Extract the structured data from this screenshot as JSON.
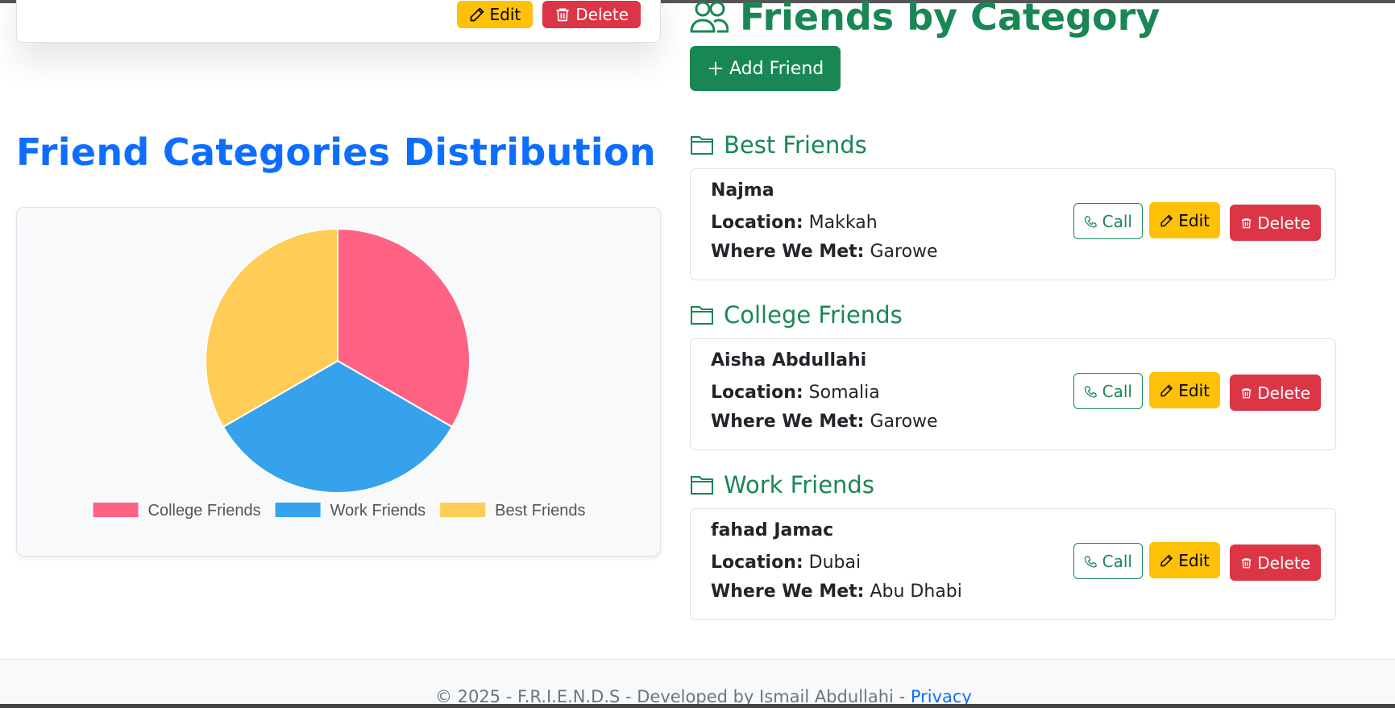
{
  "previous_card": {
    "edit_label": "Edit",
    "delete_label": "Delete"
  },
  "distribution": {
    "title": "Friend Categories Distribution"
  },
  "chart_data": {
    "type": "pie",
    "categories": [
      "College Friends",
      "Work Friends",
      "Best Friends"
    ],
    "values": [
      1,
      1,
      1
    ],
    "colors": [
      "#ff6384",
      "#36a2eb",
      "#ffcd56"
    ],
    "legend_position": "bottom"
  },
  "categories_panel": {
    "title": "Friends by Category",
    "add_button_label": "Add Friend"
  },
  "labels": {
    "location": "Location:",
    "where_met": "Where We Met:",
    "call": "Call",
    "edit": "Edit",
    "delete": "Delete"
  },
  "groups": [
    {
      "name": "Best Friends",
      "friend": {
        "name": "Najma",
        "location": "Makkah",
        "where_met": "Garowe"
      }
    },
    {
      "name": "College Friends",
      "friend": {
        "name": "Aisha Abdullahi",
        "location": "Somalia",
        "where_met": "Garowe"
      }
    },
    {
      "name": "Work Friends",
      "friend": {
        "name": "fahad Jamac",
        "location": "Dubai",
        "where_met": "Abu Dhabi"
      }
    }
  ],
  "footer": {
    "text": "© 2025 - F.R.I.E.N.D.S - Developed by Ismail Abdullahi - ",
    "privacy_link": "Privacy"
  },
  "theme": {
    "primary": "#0d6efd",
    "success": "#198754",
    "warning": "#ffc107",
    "danger": "#dc3545"
  }
}
